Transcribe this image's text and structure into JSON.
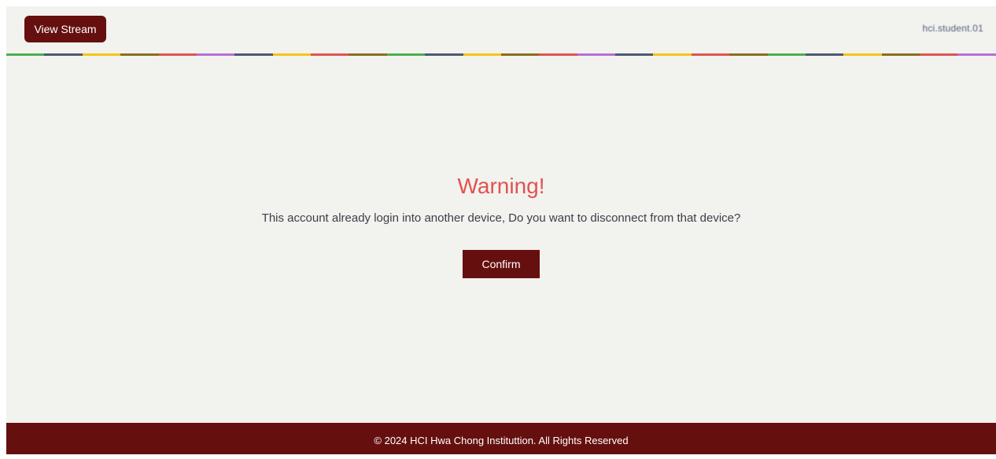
{
  "header": {
    "view_stream_label": "View Stream",
    "user_label": "hci.student.01"
  },
  "dialog": {
    "title": "Warning!",
    "message": "This account already login into another device, Do you want to disconnect from that device?",
    "confirm_label": "Confirm"
  },
  "footer": {
    "copyright": "© 2024 HCI Hwa Chong Instituttion. All Rights Reserved"
  },
  "colors": {
    "brand": "#65100f",
    "background": "#f2f2ee",
    "warning_title": "#e05350",
    "stripe": [
      "#4caf50",
      "#4a5a70",
      "#f5c518",
      "#8a6d1e",
      "#e05350",
      "#b56fd6",
      "#4a5a70",
      "#f5c518",
      "#e05350",
      "#8a6d1e"
    ]
  }
}
